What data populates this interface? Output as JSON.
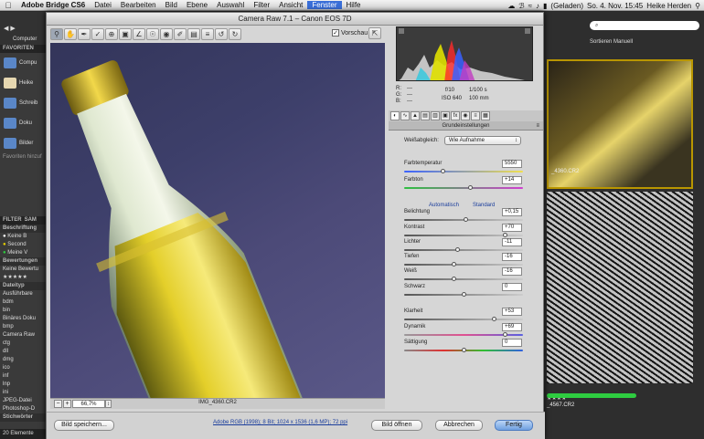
{
  "menubar": {
    "app": "Adobe Bridge CS6",
    "items": [
      "Datei",
      "Bearbeiten",
      "Bild",
      "Ebene",
      "Auswahl",
      "Filter",
      "Ansicht",
      "Fenster",
      "Hilfe"
    ],
    "selected_index": 7,
    "battery": "(Geladen)",
    "clock": "So. 4. Nov. 15:45",
    "user": "Heike Herden"
  },
  "bridge": {
    "top_label": "Computer",
    "favorites_header": "FAVORITEN",
    "favorites": [
      "Compu",
      "Heike",
      "Schreib",
      "Doku",
      "Bilder"
    ],
    "favorites_hint": "Favoriten hinzuf",
    "filter_tabs": [
      "FILTER",
      "SAM"
    ],
    "sections": [
      {
        "header": "Beschriftung",
        "rows": [
          "Keine B",
          "Second",
          "Meine V"
        ]
      },
      {
        "header": "Bewertungen",
        "rows": [
          "Keine Bewertu",
          "★★★★★"
        ]
      },
      {
        "header": "Dateityp",
        "rows": [
          "Ausführbare",
          "bdm",
          "bin",
          "Binäres Doku",
          "bmp",
          "Camera Raw",
          "ctg",
          "dll",
          "dmg",
          "ico",
          "inf",
          "lnp",
          "ini",
          "JPEG-Datei",
          "Photoshop-D"
        ]
      },
      {
        "header": "Stichwörter",
        "rows": []
      }
    ],
    "status": "20 Elemente",
    "search_placeholder": "⌕",
    "sort_label": "Sortieren Manuell",
    "thumb1_label": "_4360.CR2",
    "thumb2_stars": "★★★★",
    "thumb2_label": "_4567.CR2"
  },
  "camera_raw": {
    "title": "Camera Raw 7.1  –  Canon EOS 7D",
    "preview_label": "Vorschau",
    "preview_checked": true,
    "zoom": "66,7%",
    "filename": "IMG_4360.CR2",
    "exif": {
      "r": "R:",
      "g": "G:",
      "b": "B:",
      "r_val": "---",
      "g_val": "---",
      "b_val": "---",
      "aperture": "f/10",
      "shutter": "1/100 s",
      "iso": "ISO 640",
      "focal": "100 mm"
    },
    "section_title": "Grundeinstellungen",
    "white_balance_label": "Weißabgleich:",
    "white_balance_value": "Wie Aufnahme",
    "auto_label": "Automatisch",
    "default_label": "Standard",
    "sliders": [
      {
        "label": "Farbtemperatur",
        "value": "5550",
        "pos": 0.33,
        "track": "temp"
      },
      {
        "label": "Farbton",
        "value": "+14",
        "pos": 0.56,
        "track": "tint"
      },
      {
        "label": "Belichtung",
        "value": "+0,15",
        "pos": 0.52,
        "track": "gray"
      },
      {
        "label": "Kontrast",
        "value": "+70",
        "pos": 0.85,
        "track": "gray"
      },
      {
        "label": "Lichter",
        "value": "-11",
        "pos": 0.45,
        "track": "gray"
      },
      {
        "label": "Tiefen",
        "value": "-16",
        "pos": 0.42,
        "track": "gray"
      },
      {
        "label": "Weiß",
        "value": "-16",
        "pos": 0.42,
        "track": "gray"
      },
      {
        "label": "Schwarz",
        "value": "0",
        "pos": 0.5,
        "track": "gray"
      },
      {
        "label": "Klarheit",
        "value": "+53",
        "pos": 0.76,
        "track": "gray"
      },
      {
        "label": "Dynamik",
        "value": "+69",
        "pos": 0.85,
        "track": "vibrance"
      },
      {
        "label": "Sättigung",
        "value": "0",
        "pos": 0.5,
        "track": "saturation"
      }
    ],
    "buttons": {
      "save": "Bild speichern...",
      "open": "Bild öffnen",
      "cancel": "Abbrechen",
      "done": "Fertig"
    },
    "workflow": "Adobe RGB (1998); 8 Bit; 1024 x 1536 (1,6 MP); 72 ppi"
  }
}
